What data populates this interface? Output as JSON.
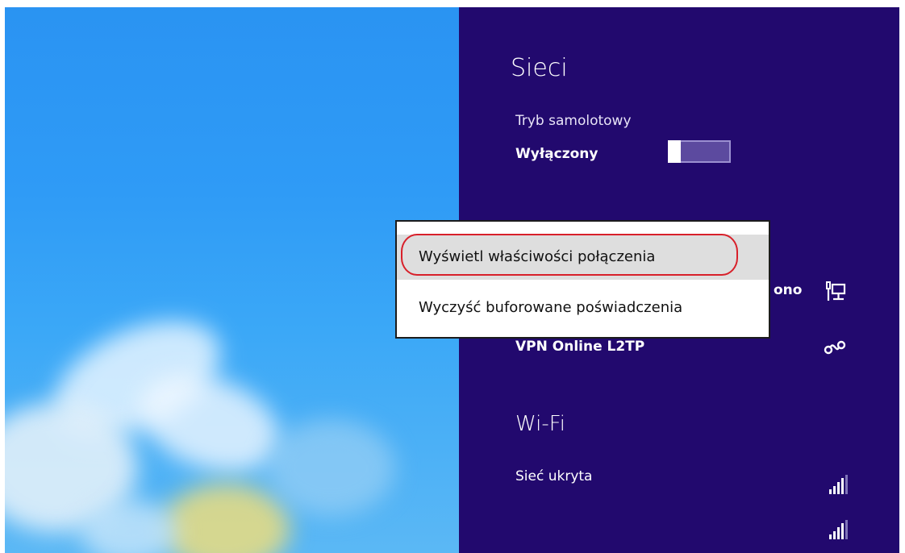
{
  "panel": {
    "title": "Sieci",
    "background_color": "#22096e",
    "airplane_mode": {
      "label": "Tryb samolotowy",
      "state": "Wyłączony",
      "on": false
    },
    "connections": [
      {
        "name": "ono",
        "icon": "wired-network-icon"
      },
      {
        "name": "VPN Online L2TP",
        "icon": "vpn-icon"
      }
    ],
    "wifi": {
      "heading": "Wi-Fi",
      "networks": [
        {
          "name": "Sieć ukryta",
          "icon": "wifi-signal-icon",
          "signal_bars": 4
        },
        {
          "name": "",
          "icon": "wifi-signal-icon",
          "signal_bars": 4
        }
      ]
    }
  },
  "context_menu": {
    "items": [
      {
        "label": "Wyświetl właściwości połączenia",
        "highlighted": true,
        "annotated": true
      },
      {
        "label": "Wyczyść buforowane poświadczenia",
        "highlighted": false
      }
    ],
    "annotation_color": "#d8202a"
  }
}
